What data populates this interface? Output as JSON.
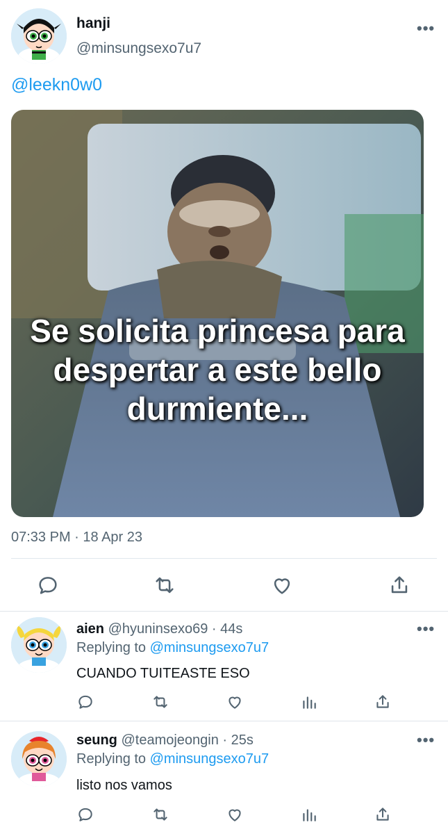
{
  "main_tweet": {
    "display_name": "hanji",
    "handle": "@minsungsexo7u7",
    "text": "@leekn0w0",
    "image_caption": "Se solicita princesa para despertar a este bello durmiente...",
    "timestamp": "07:33 PM · 18 Apr 23",
    "more": "•••"
  },
  "replies": [
    {
      "display_name": "aien",
      "handle": "@hyuninsexo69",
      "time": "· 44s",
      "replying_label": "Replying to",
      "replying_to": "@minsungsexo7u7",
      "text": "CUANDO TUITEASTE ESO",
      "more": "•••"
    },
    {
      "display_name": "seung",
      "handle": "@teamojeongin",
      "time": "· 25s",
      "replying_label": "Replying to",
      "replying_to": "@minsungsexo7u7",
      "text": "listo nos vamos",
      "more": "•••"
    }
  ],
  "icons": {
    "reply": "reply-icon",
    "retweet": "retweet-icon",
    "like": "like-icon",
    "views": "views-icon",
    "share": "share-icon"
  },
  "colors": {
    "accent": "#1d9bf0",
    "secondary_text": "#536471",
    "divider": "#e1e8ed"
  }
}
